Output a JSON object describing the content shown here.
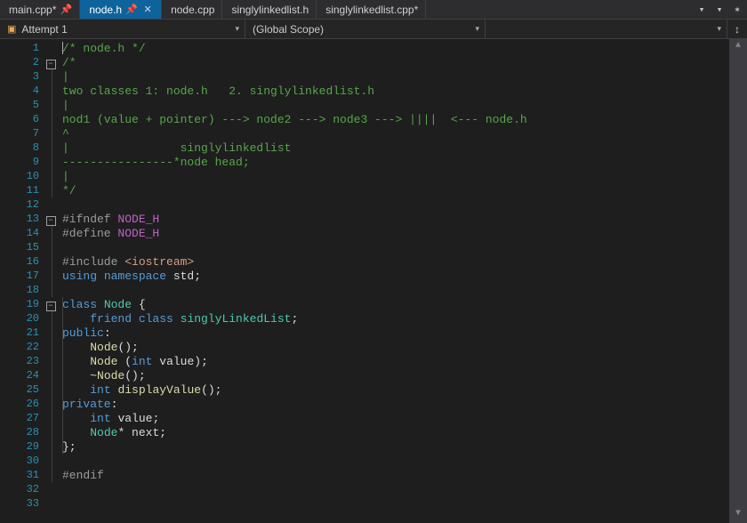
{
  "tabs": [
    {
      "label": "main.cpp*",
      "active": false,
      "pinned": true
    },
    {
      "label": "node.h",
      "active": true,
      "pinned": true,
      "closeable": true
    },
    {
      "label": "node.cpp",
      "active": false
    },
    {
      "label": "singlylinkedlist.h",
      "active": false
    },
    {
      "label": "singlylinkedlist.cpp*",
      "active": false
    }
  ],
  "strip_right": {
    "menu": "▾",
    "caret": "▾",
    "gear": "✶"
  },
  "context": {
    "scope_icon": "◈",
    "scope_label": "Attempt 1",
    "global_label": "(Global Scope)",
    "member_label": "",
    "split_icon": "↕"
  },
  "code": {
    "lines": [
      {
        "n": 1,
        "fold": "",
        "segs": [
          {
            "cls": "caret",
            "t": ""
          },
          {
            "cls": "tok-comment",
            "t": "/* node.h */"
          }
        ]
      },
      {
        "n": 2,
        "fold": "box",
        "segs": [
          {
            "cls": "tok-comment",
            "t": "/*"
          }
        ]
      },
      {
        "n": 3,
        "fold": "line",
        "segs": [
          {
            "cls": "tok-comment",
            "t": "|"
          }
        ]
      },
      {
        "n": 4,
        "fold": "line",
        "segs": [
          {
            "cls": "tok-comment",
            "t": "two classes 1: node.h   2. singlylinkedlist.h"
          }
        ]
      },
      {
        "n": 5,
        "fold": "line",
        "segs": [
          {
            "cls": "tok-comment",
            "t": "|"
          }
        ]
      },
      {
        "n": 6,
        "fold": "line",
        "segs": [
          {
            "cls": "tok-comment",
            "t": "nod1 (value + pointer) ---> node2 ---> node3 ---> ||||  <--- node.h"
          }
        ]
      },
      {
        "n": 7,
        "fold": "line",
        "segs": [
          {
            "cls": "tok-comment",
            "t": "^"
          }
        ]
      },
      {
        "n": 8,
        "fold": "line",
        "segs": [
          {
            "cls": "tok-comment",
            "t": "|                singlylinkedlist"
          }
        ]
      },
      {
        "n": 9,
        "fold": "line",
        "segs": [
          {
            "cls": "tok-comment",
            "t": "----------------*node head;"
          }
        ]
      },
      {
        "n": 10,
        "fold": "line",
        "segs": [
          {
            "cls": "tok-comment",
            "t": "|"
          }
        ]
      },
      {
        "n": 11,
        "fold": "end",
        "segs": [
          {
            "cls": "tok-comment",
            "t": "*/"
          }
        ]
      },
      {
        "n": 12,
        "fold": "",
        "segs": []
      },
      {
        "n": 13,
        "fold": "box",
        "segs": [
          {
            "cls": "tok-preproc",
            "t": "#ifndef "
          },
          {
            "cls": "tok-macro",
            "t": "NODE_H"
          }
        ]
      },
      {
        "n": 14,
        "fold": "line",
        "segs": [
          {
            "cls": "tok-preproc",
            "t": "#define "
          },
          {
            "cls": "tok-macro",
            "t": "NODE_H"
          }
        ]
      },
      {
        "n": 15,
        "fold": "line",
        "segs": []
      },
      {
        "n": 16,
        "fold": "line",
        "segs": [
          {
            "cls": "tok-preproc",
            "t": "#include "
          },
          {
            "cls": "tok-string",
            "t": "<iostream>"
          }
        ]
      },
      {
        "n": 17,
        "fold": "line",
        "segs": [
          {
            "cls": "tok-keyword",
            "t": "using "
          },
          {
            "cls": "tok-keyword",
            "t": "namespace "
          },
          {
            "cls": "tok-ident",
            "t": "std"
          },
          {
            "cls": "tok-punct",
            "t": ";"
          }
        ]
      },
      {
        "n": 18,
        "fold": "line",
        "segs": []
      },
      {
        "n": 19,
        "fold": "box2",
        "segs": [
          {
            "cls": "tok-keyword",
            "t": "class "
          },
          {
            "cls": "tok-class",
            "t": "Node"
          },
          {
            "cls": "tok-punct",
            "t": " {"
          }
        ]
      },
      {
        "n": 20,
        "fold": "line2",
        "segs": [
          {
            "cls": "tok-punct",
            "t": "    "
          },
          {
            "cls": "tok-keyword",
            "t": "friend class "
          },
          {
            "cls": "tok-class",
            "t": "singlyLinkedList"
          },
          {
            "cls": "tok-punct",
            "t": ";"
          }
        ]
      },
      {
        "n": 21,
        "fold": "line2",
        "segs": [
          {
            "cls": "tok-keyword",
            "t": "public"
          },
          {
            "cls": "tok-punct",
            "t": ":"
          }
        ]
      },
      {
        "n": 22,
        "fold": "line2",
        "segs": [
          {
            "cls": "tok-punct",
            "t": "    "
          },
          {
            "cls": "tok-func",
            "t": "Node"
          },
          {
            "cls": "tok-punct",
            "t": "();"
          }
        ]
      },
      {
        "n": 23,
        "fold": "line2",
        "segs": [
          {
            "cls": "tok-punct",
            "t": "    "
          },
          {
            "cls": "tok-func",
            "t": "Node "
          },
          {
            "cls": "tok-punct",
            "t": "("
          },
          {
            "cls": "tok-keyword",
            "t": "int "
          },
          {
            "cls": "tok-ident",
            "t": "value"
          },
          {
            "cls": "tok-punct",
            "t": ");"
          }
        ]
      },
      {
        "n": 24,
        "fold": "line2",
        "segs": [
          {
            "cls": "tok-punct",
            "t": "    ~"
          },
          {
            "cls": "tok-func",
            "t": "Node"
          },
          {
            "cls": "tok-punct",
            "t": "();"
          }
        ]
      },
      {
        "n": 25,
        "fold": "line2",
        "segs": [
          {
            "cls": "tok-punct",
            "t": "    "
          },
          {
            "cls": "tok-keyword",
            "t": "int "
          },
          {
            "cls": "tok-func",
            "t": "displayValue"
          },
          {
            "cls": "tok-punct",
            "t": "();"
          }
        ]
      },
      {
        "n": 26,
        "fold": "line2",
        "segs": [
          {
            "cls": "tok-keyword",
            "t": "private"
          },
          {
            "cls": "tok-punct",
            "t": ":"
          }
        ]
      },
      {
        "n": 27,
        "fold": "line2",
        "segs": [
          {
            "cls": "tok-punct",
            "t": "    "
          },
          {
            "cls": "tok-keyword",
            "t": "int "
          },
          {
            "cls": "tok-ident",
            "t": "value"
          },
          {
            "cls": "tok-punct",
            "t": ";"
          }
        ]
      },
      {
        "n": 28,
        "fold": "line2",
        "segs": [
          {
            "cls": "tok-punct",
            "t": "    "
          },
          {
            "cls": "tok-class",
            "t": "Node"
          },
          {
            "cls": "tok-punct",
            "t": "* "
          },
          {
            "cls": "tok-ident",
            "t": "next"
          },
          {
            "cls": "tok-punct",
            "t": ";"
          }
        ]
      },
      {
        "n": 29,
        "fold": "end2",
        "segs": [
          {
            "cls": "tok-punct",
            "t": "};"
          }
        ]
      },
      {
        "n": 30,
        "fold": "line",
        "segs": []
      },
      {
        "n": 31,
        "fold": "end",
        "segs": [
          {
            "cls": "tok-preproc",
            "t": "#endif"
          }
        ]
      },
      {
        "n": 32,
        "fold": "",
        "segs": []
      },
      {
        "n": 33,
        "fold": "",
        "segs": []
      }
    ]
  },
  "fold_glyph": "−",
  "sb": {
    "up": "▲",
    "down": "▼"
  }
}
